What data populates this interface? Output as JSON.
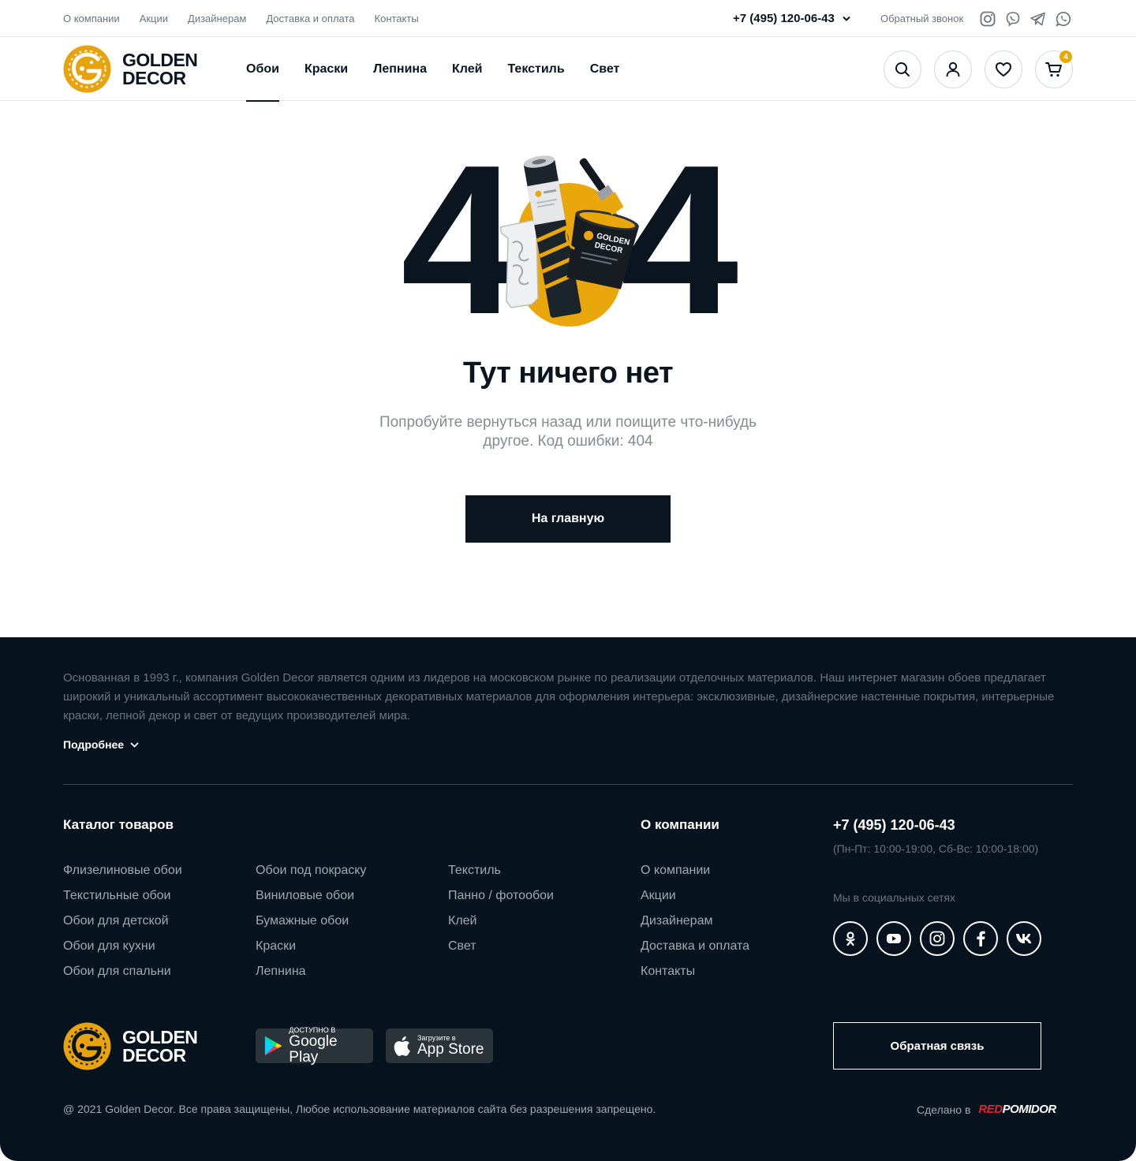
{
  "topbar": {
    "links": [
      "О компании",
      "Акции",
      "Дизайнерам",
      "Доставка и оплата",
      "Контакты"
    ],
    "phone": "+7 (495) 120-06-43",
    "callback": "Обратный звонок"
  },
  "header": {
    "logo_line1": "GOLDEN",
    "logo_line2": "DECOR",
    "nav": [
      "Обои",
      "Краски",
      "Лепнина",
      "Клей",
      "Текстиль",
      "Свет"
    ],
    "active_nav": "Обои",
    "cart_count": "4"
  },
  "error": {
    "digit_left": "4",
    "digit_right": "4",
    "title": "Тут ничего нет",
    "subtitle": "Попробуйте вернуться назад или поищите что-нибудь другое. Код ошибки: 404",
    "home_button": "На главную"
  },
  "footer": {
    "about": "Основанная в 1993 г., компания Golden Decor является одним из лидеров на московском рынке по реализации отделочных материалов. Наш интернет магазин обоев предлагает широкий и уникальный ассортимент высококачественных декоративных материалов для оформления интерьера: эксклюзивные, дизайнерские настенные покрытия, интерьерные краски, лепной декор и свет от ведущих производителей мира.",
    "more": "Подробнее",
    "catalog_title": "Каталог товаров",
    "catalog_col1": [
      "Флизелиновые обои",
      "Текстильные обои",
      "Обои для детской",
      "Обои для кухни",
      "Обои для спальни"
    ],
    "catalog_col2": [
      "Обои под покраску",
      "Виниловые обои",
      "Бумажные обои",
      "Краски",
      "Лепнина"
    ],
    "catalog_col3": [
      "Текстиль",
      "Панно / фотообои",
      "Клей",
      "Свет"
    ],
    "company_title": "О компании",
    "company_links": [
      "О компании",
      "Акции",
      "Дизайнерам",
      "Доставка и оплата",
      "Контакты"
    ],
    "phone": "+7 (495) 120-06-43",
    "hours": "(Пн-Пт: 10:00-19:00, Сб-Вс: 10:00-18:00)",
    "social_label": "Мы в социальных сетях",
    "google_small": "ДОСТУПНО В",
    "google_big": "Google Play",
    "apple_small": "Загрузите в",
    "apple_big": "App Store",
    "feedback": "Обратная связь",
    "copyright": "@ 2021 Golden Decor. Все права защищены, Любое использование материалов сайта без разрешения запрещено.",
    "made_in": "Сделано в",
    "made_red": "RED",
    "made_white": "POMIDOR"
  },
  "colors": {
    "accent": "#eaa70b",
    "dark": "#0a1520",
    "footer_bg": "#06121d"
  }
}
